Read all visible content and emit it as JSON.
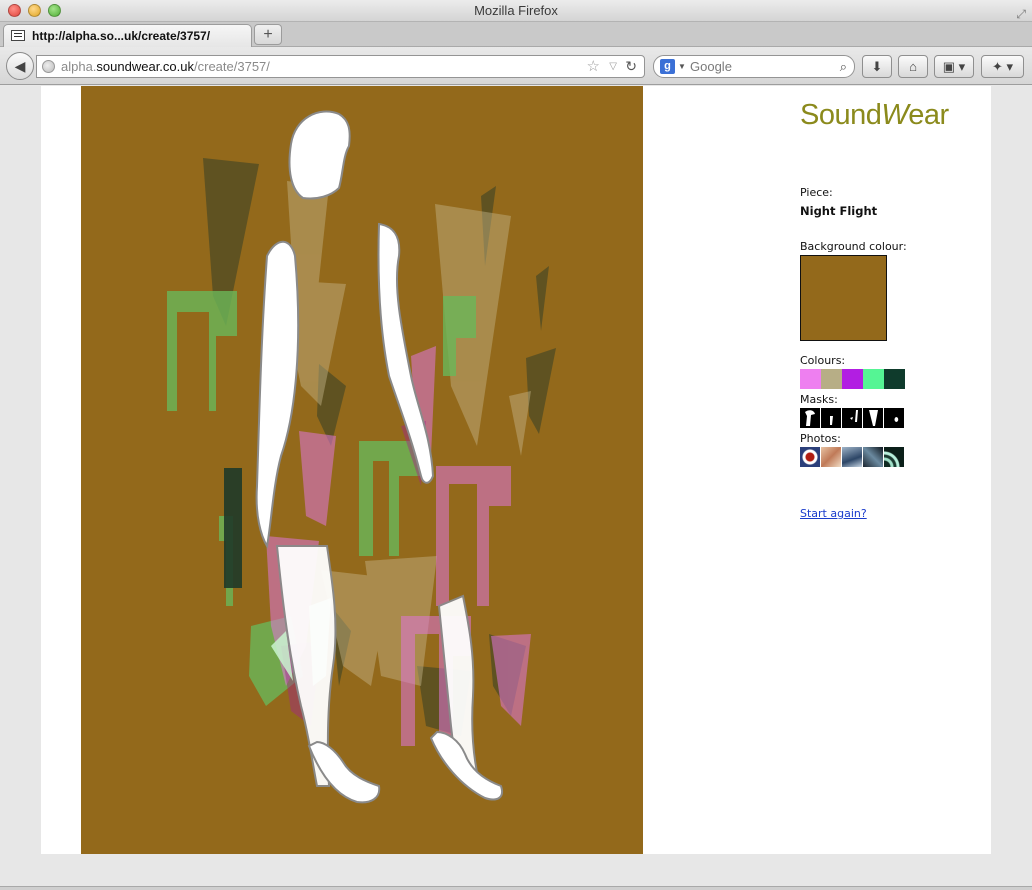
{
  "window": {
    "title": "Mozilla Firefox"
  },
  "tab": {
    "title": "http://alpha.so...uk/create/3757/",
    "close_glyph": "/"
  },
  "url": {
    "prefix": "alpha.",
    "host": "soundwear.co.uk",
    "path": "/create/3757/"
  },
  "search": {
    "engine_glyph": "g",
    "placeholder": "Google"
  },
  "sidebar": {
    "logo_plain": "Sound",
    "logo_italic": "W",
    "logo_rest": "ear",
    "piece_label": "Piece:",
    "piece_name": "Night Flight",
    "background_label": "Background colour:",
    "background_color": "#93691b",
    "colours_label": "Colours:",
    "colours": [
      "#ee7ff0",
      "#b7ae86",
      "#b21ee2",
      "#55f594",
      "#0f3b2c"
    ],
    "masks_label": "Masks:",
    "photos_label": "Photos:",
    "start_again": "Start again?"
  }
}
